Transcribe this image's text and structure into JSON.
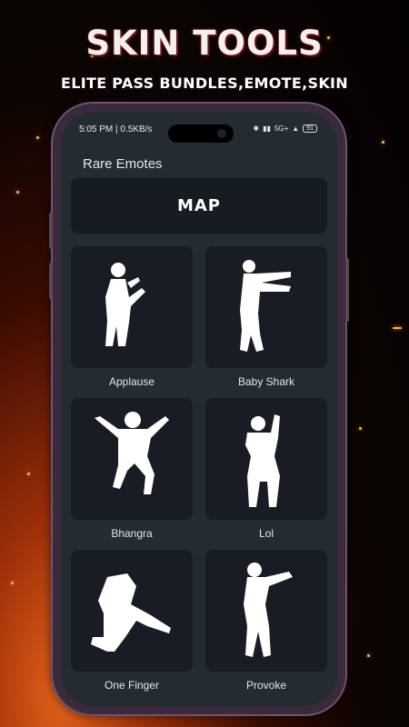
{
  "promo": {
    "title": "SKIN TOOLS",
    "subtitle": "ELITE PASS BUNDLES,EMOTE,SKIN"
  },
  "status_bar": {
    "time_speed": "5:05 PM | 0.5KB/s",
    "network": "5G+",
    "battery": "91"
  },
  "screen": {
    "title": "Rare Emotes",
    "map_button": "MAP",
    "emotes": [
      {
        "label": "Applause",
        "icon": "applause-figure-icon"
      },
      {
        "label": "Baby Shark",
        "icon": "baby-shark-figure-icon"
      },
      {
        "label": "Bhangra",
        "icon": "bhangra-figure-icon"
      },
      {
        "label": "Lol",
        "icon": "lol-figure-icon"
      },
      {
        "label": "One Finger",
        "icon": "one-finger-figure-icon"
      },
      {
        "label": "Provoke",
        "icon": "provoke-figure-icon"
      }
    ]
  }
}
